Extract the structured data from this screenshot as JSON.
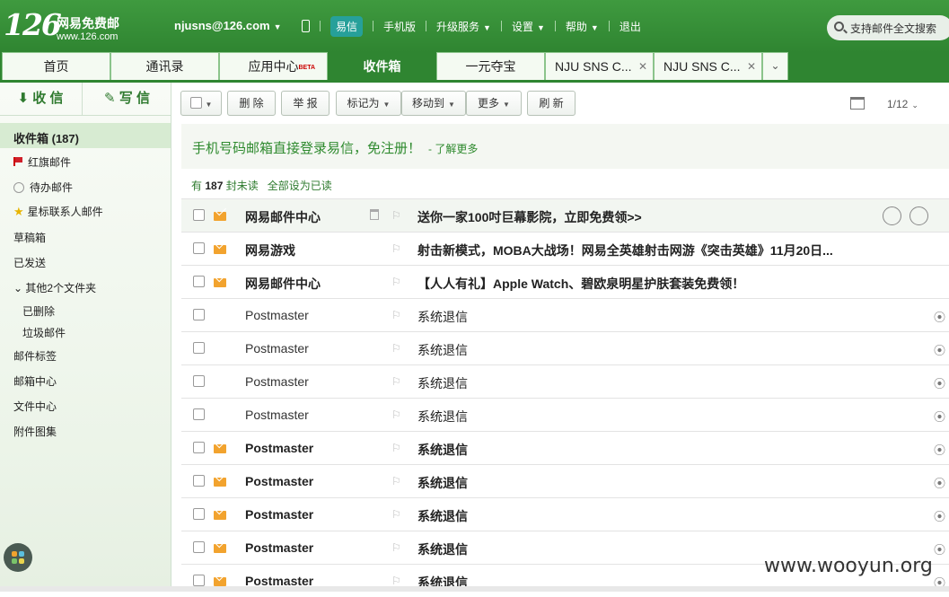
{
  "header": {
    "logo": "126",
    "logo_name": "网易免费邮",
    "logo_url": "www.126.com",
    "user": "njusns@126.com",
    "nav": {
      "yixin": "易信",
      "mobile": "手机版",
      "upgrade": "升级服务",
      "settings": "设置",
      "help": "帮助",
      "logout": "退出"
    },
    "search_placeholder": "支持邮件全文搜索"
  },
  "tabs": [
    {
      "label": "首页"
    },
    {
      "label": "通讯录"
    },
    {
      "label": "应用中心",
      "badge": "BETA"
    },
    {
      "label": "收件箱"
    },
    {
      "label": "一元夺宝"
    },
    {
      "label": "NJU SNS C..."
    },
    {
      "label": "NJU SNS C..."
    }
  ],
  "sidebar": {
    "receive": "收 信",
    "write": "写 信",
    "folders": {
      "inbox": "收件箱 (187)",
      "flagged": "红旗邮件",
      "todo": "待办邮件",
      "starred": "星标联系人邮件",
      "drafts": "草稿箱",
      "sent": "已发送",
      "others": "其他2个文件夹",
      "deleted": "已删除",
      "spam": "垃圾邮件",
      "tags": "邮件标签",
      "mailbox_center": "邮箱中心",
      "file_center": "文件中心",
      "attachments": "附件图集"
    }
  },
  "toolbar": {
    "delete": "删 除",
    "report": "举 报",
    "mark_as": "标记为",
    "move_to": "移动到",
    "more": "更多",
    "refresh": "刷 新",
    "pager": "1/12"
  },
  "notice": {
    "text": "手机号码邮箱直接登录易信，免注册！",
    "link": "- 了解更多"
  },
  "summary": {
    "prefix": "有",
    "count": "187",
    "suffix": "封未读",
    "mark_all": "全部设为已读"
  },
  "emails": [
    {
      "from": "网易邮件中心",
      "subject": "送你一家100吋巨幕影院，立即免费领>>",
      "unread": true,
      "attachment": false
    },
    {
      "from": "网易游戏",
      "subject": "射击新模式，MOBA大战场！网易全英雄射击网游《突击英雄》11月20日...",
      "unread": true,
      "attachment": false
    },
    {
      "from": "网易邮件中心",
      "subject": "【人人有礼】Apple Watch、碧欧泉明星护肤套装免费领！",
      "unread": true,
      "attachment": false
    },
    {
      "from": "Postmaster",
      "subject": "系统退信",
      "unread": false,
      "attachment": true
    },
    {
      "from": "Postmaster",
      "subject": "系统退信",
      "unread": false,
      "attachment": true
    },
    {
      "from": "Postmaster",
      "subject": "系统退信",
      "unread": false,
      "attachment": true
    },
    {
      "from": "Postmaster",
      "subject": "系统退信",
      "unread": false,
      "attachment": true
    },
    {
      "from": "Postmaster",
      "subject": "系统退信",
      "unread": true,
      "attachment": true
    },
    {
      "from": "Postmaster",
      "subject": "系统退信",
      "unread": true,
      "attachment": true
    },
    {
      "from": "Postmaster",
      "subject": "系统退信",
      "unread": true,
      "attachment": true
    },
    {
      "from": "Postmaster",
      "subject": "系统退信",
      "unread": true,
      "attachment": true
    },
    {
      "from": "Postmaster",
      "subject": "系统退信",
      "unread": true,
      "attachment": true
    }
  ],
  "watermark": "www.wooyun.org"
}
